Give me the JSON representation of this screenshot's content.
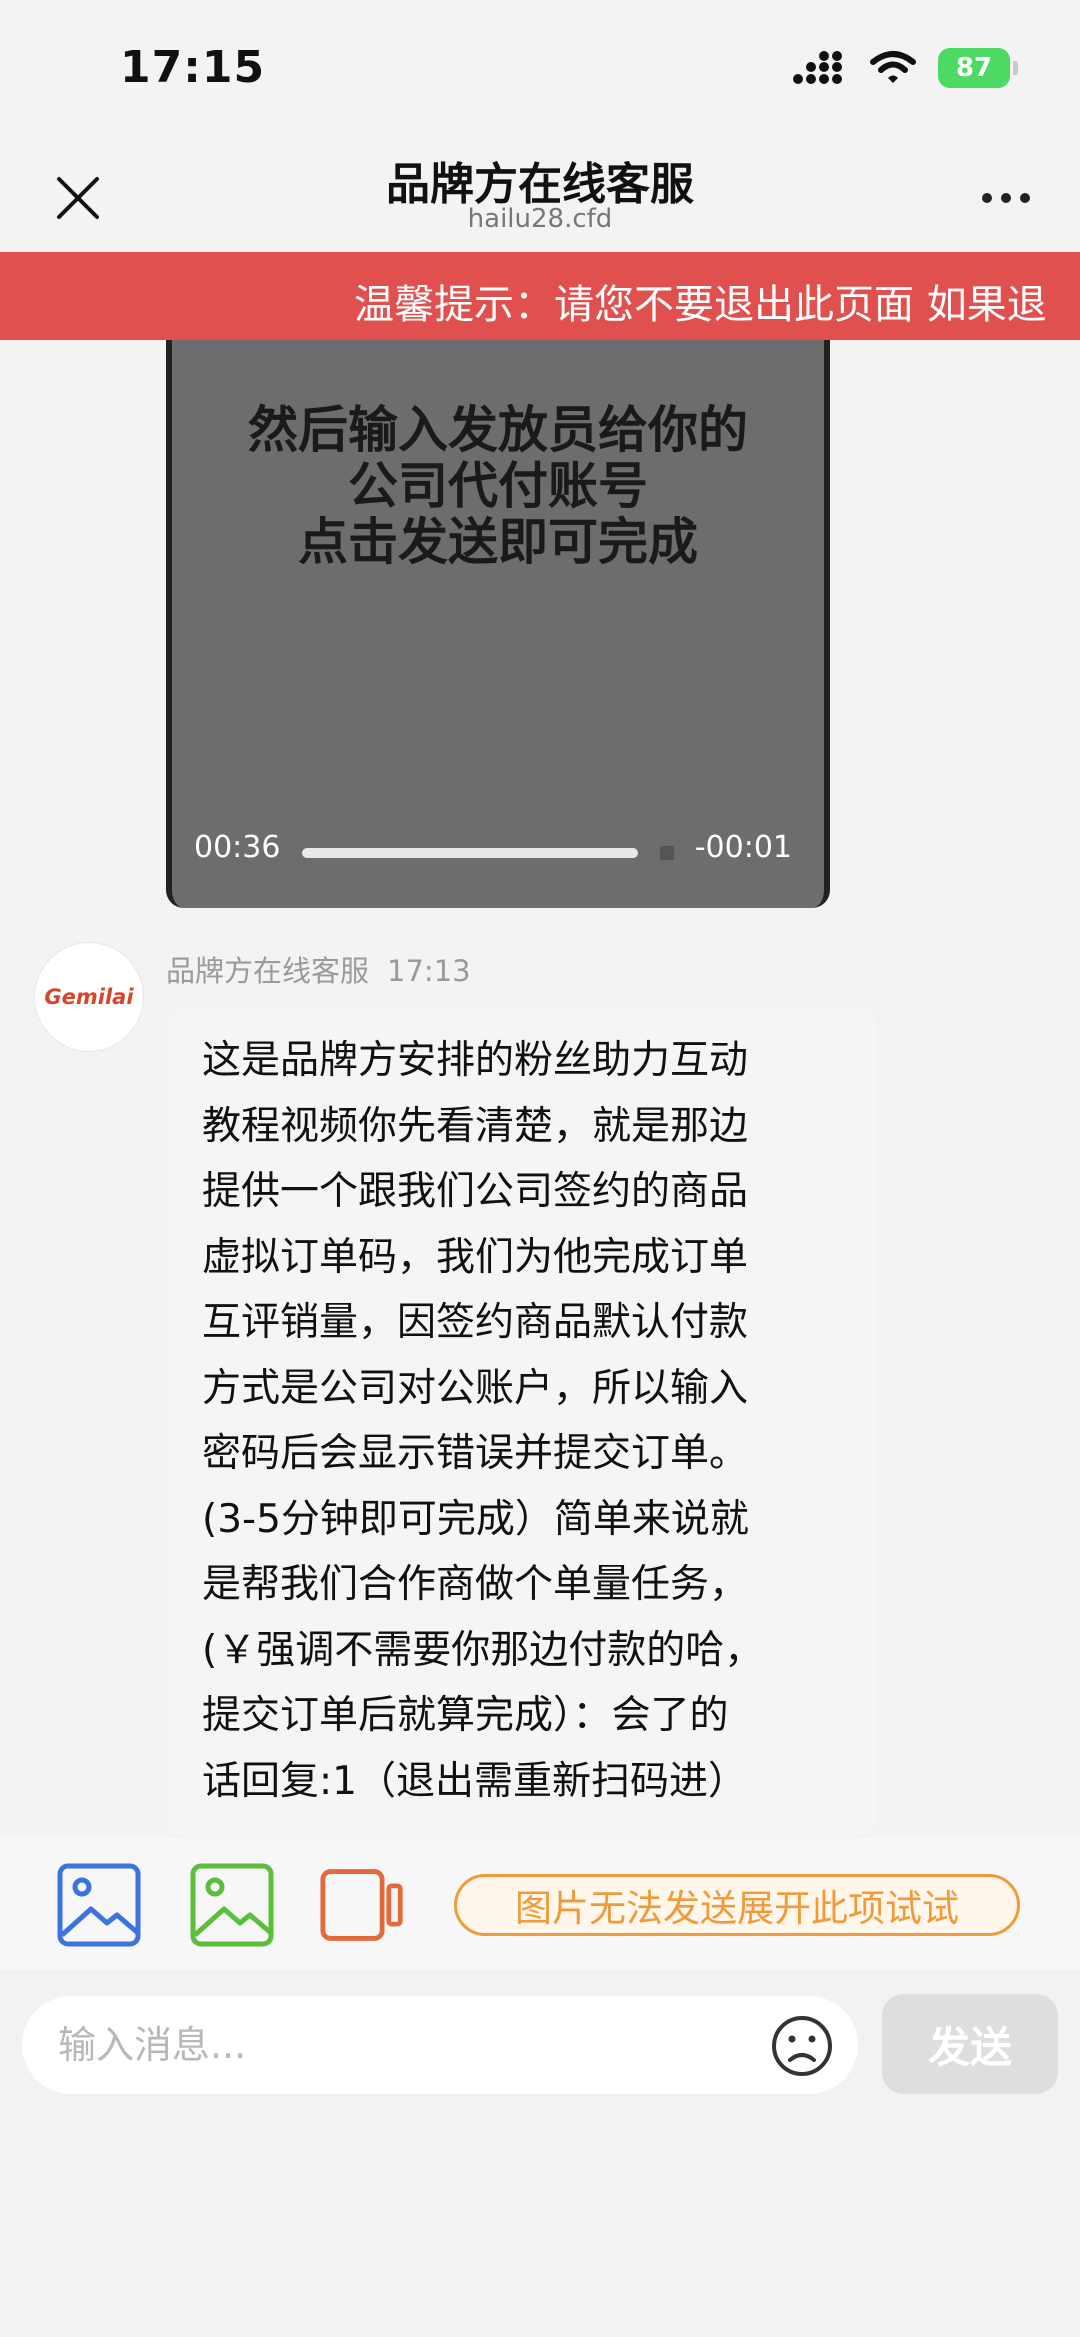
{
  "status_bar": {
    "time": "17:15",
    "battery": "87"
  },
  "header": {
    "title": "品牌方在线客服",
    "subtitle": "hailu28.cfd"
  },
  "notice": {
    "text": "温馨提示：请您不要退出此页面 如果退"
  },
  "video": {
    "caption_lines": [
      "然后输入发放员给你的",
      "公司代付账号",
      "点击发送即可完成"
    ],
    "current_time": "00:36",
    "remaining_time": "-00:01",
    "progress": 0.97
  },
  "message": {
    "avatar_text": "Gemilai",
    "sender": "品牌方在线客服",
    "time": "17:13",
    "lines": [
      "这是品牌方安排的粉丝助力互动",
      "教程视频你先看清楚，就是那边",
      "提供一个跟我们公司签约的商品",
      "虚拟订单码，我们为他完成订单",
      "互评销量，因签约商品默认付款",
      "方式是公司对公账户，所以输入",
      "密码后会显示错误并提交订单。",
      "(3-5分钟即可完成）简单来说就",
      "是帮我们合作商做个单量任务，",
      "(￥强调不需要你那边付款的哈，",
      "提交订单后就算完成）：会了的",
      "话回复:1（退出需重新扫码进）"
    ]
  },
  "toolbar": {
    "tip_button": "图片无法发送展开此项试试",
    "colors": {
      "image1": "#3b74e0",
      "image2": "#5bbf3a",
      "video": "#e36a3b",
      "tip": "#f09a3a"
    }
  },
  "input": {
    "placeholder": "输入消息...",
    "send_label": "发送"
  }
}
